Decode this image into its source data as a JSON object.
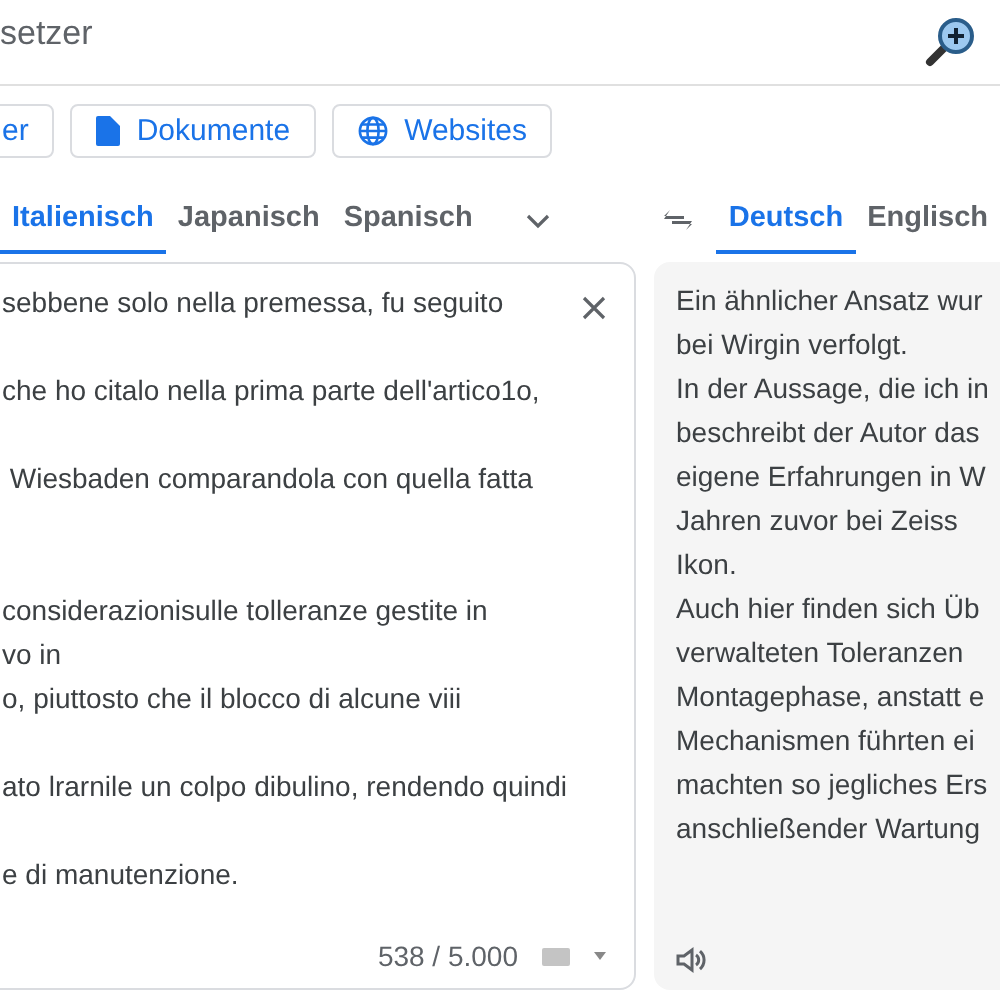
{
  "header": {
    "title": "setzer"
  },
  "modes": [
    {
      "label": "er",
      "kind": "plain"
    },
    {
      "label": "Dokumente",
      "kind": "document"
    },
    {
      "label": "Websites",
      "kind": "globe"
    }
  ],
  "source_languages": [
    {
      "label": "Italienisch",
      "selected": true
    },
    {
      "label": "Japanisch",
      "selected": false
    },
    {
      "label": "Spanisch",
      "selected": false
    }
  ],
  "target_languages": [
    {
      "label": "Deutsch",
      "selected": true
    },
    {
      "label": "Englisch",
      "selected": false
    }
  ],
  "source": {
    "value": "sebbene solo nella premessa, fu seguito\n\nche ho citalo nella prima parte dell'artico1o,\n\n Wiesbaden comparandola con quella fatta\n\n\nconsiderazionisulle tolleranze gestite in\nvo in\no, piuttosto che il blocco di alcune viii\n\nato lrarnile un colpo dibulino, rendendo quindi\n\ne di manutenzione.",
    "count": "538 / 5.000"
  },
  "target": {
    "text": "Ein ähnlicher Ansatz wur\nbei Wirgin verfolgt.\nIn der Aussage, die ich in\nbeschreibt der Autor das\neigene Erfahrungen in W\nJahren zuvor bei Zeiss\nIkon.\nAuch hier finden sich Üb\nverwalteten Toleranzen\nMontagephase, anstatt e\nMechanismen führten ei\nmachten so jegliches Ers\nanschließender Wartung"
  }
}
